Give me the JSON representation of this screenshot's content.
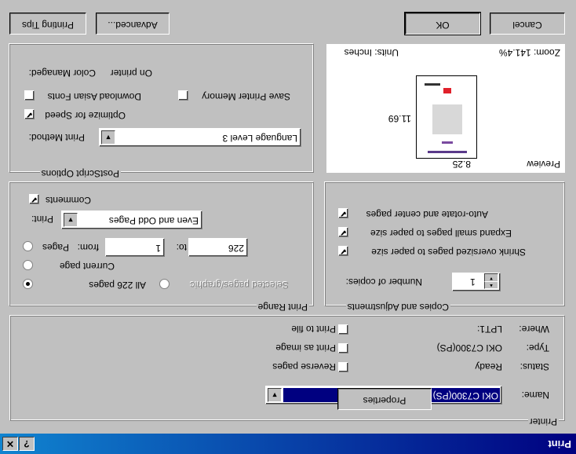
{
  "window": {
    "title": "Print",
    "help_glyph": "?",
    "close_glyph": "✕"
  },
  "printer": {
    "legend": "Printer",
    "name_label": "Name:",
    "name_value": "OKI C7300(PS)",
    "status_label": "Status:",
    "status_value": "Ready",
    "type_label": "Type:",
    "type_value": "OKI C7300(PS)",
    "where_label": "Where:",
    "where_value": "LPT1:",
    "properties_label": "Properties",
    "print_to_file": "Print to file",
    "print_as_image": "Print as image",
    "reverse_pages": "Reverse pages"
  },
  "print_range": {
    "legend": "Print Range",
    "all_pages": "All 226 pages",
    "current_page": "Current page",
    "pages_label": "Pages",
    "from_label": "from:",
    "from_value": "1",
    "to_label": "to:",
    "to_value": "226",
    "selected": "Selected pages/graphic",
    "print_label": "Print:",
    "print_value": "Even and Odd Pages",
    "comments": "Comments"
  },
  "copies": {
    "legend": "Copies and Adjustments",
    "number_label": "Number of copies:",
    "number_value": "1",
    "shrink": "Shrink oversized pages to paper size",
    "expand": "Expand small pages to paper size",
    "autorotate": "Auto-rotate and center pages"
  },
  "postscript": {
    "legend": "PostScript Options",
    "method_label": "Print Method:",
    "method_value": "Language Level 3",
    "optimize": "Optimize for Speed",
    "download_fonts": "Download Asian Fonts",
    "save_memory": "Save Printer Memory",
    "color_label": "Color Managed:",
    "color_value": "On printer"
  },
  "preview": {
    "label": "Preview",
    "width_value": "8.25",
    "height_value": "11.69",
    "units": "Units: Inches",
    "zoom": "Zoom: 141.4%"
  },
  "buttons": {
    "tips": "Printing Tips",
    "advanced": "Advanced...",
    "ok": "OK",
    "cancel": "Cancel"
  },
  "check_glyph": "✔"
}
